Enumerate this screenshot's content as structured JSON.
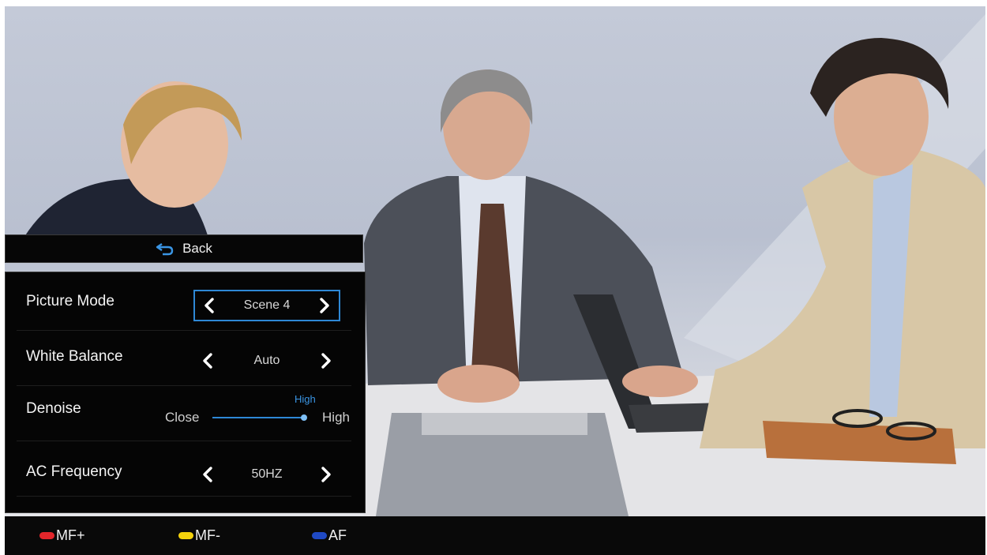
{
  "menu": {
    "back_label": "Back",
    "items": [
      {
        "label": "Picture Mode",
        "value": "Scene 4",
        "focused": true
      },
      {
        "label": "White Balance",
        "value": "Auto"
      },
      {
        "label": "Denoise",
        "slider": {
          "min_label": "Close",
          "max_label": "High",
          "current_label": "High",
          "level": 1.0
        }
      },
      {
        "label": "AC Frequency",
        "value": "50HZ"
      }
    ],
    "accent_color": "#2e88d6"
  },
  "keys": [
    {
      "label": "MF+",
      "color": "#e3262b"
    },
    {
      "label": "MF-",
      "color": "#f4d20c"
    },
    {
      "label": "AF",
      "color": "#1f49c4"
    }
  ],
  "scene": {
    "description_icon": "video-feed"
  }
}
